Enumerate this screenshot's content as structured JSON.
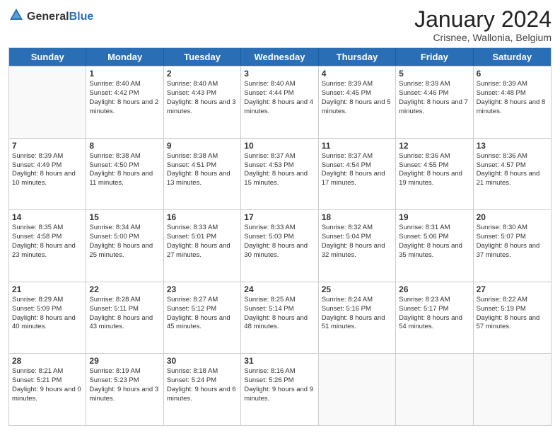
{
  "header": {
    "logo_general": "General",
    "logo_blue": "Blue",
    "month": "January 2024",
    "location": "Crisnee, Wallonia, Belgium"
  },
  "days_of_week": [
    "Sunday",
    "Monday",
    "Tuesday",
    "Wednesday",
    "Thursday",
    "Friday",
    "Saturday"
  ],
  "weeks": [
    [
      {
        "day": "",
        "sunrise": "",
        "sunset": "",
        "daylight": "",
        "empty": true
      },
      {
        "day": "1",
        "sunrise": "Sunrise: 8:40 AM",
        "sunset": "Sunset: 4:42 PM",
        "daylight": "Daylight: 8 hours and 2 minutes.",
        "empty": false
      },
      {
        "day": "2",
        "sunrise": "Sunrise: 8:40 AM",
        "sunset": "Sunset: 4:43 PM",
        "daylight": "Daylight: 8 hours and 3 minutes.",
        "empty": false
      },
      {
        "day": "3",
        "sunrise": "Sunrise: 8:40 AM",
        "sunset": "Sunset: 4:44 PM",
        "daylight": "Daylight: 8 hours and 4 minutes.",
        "empty": false
      },
      {
        "day": "4",
        "sunrise": "Sunrise: 8:39 AM",
        "sunset": "Sunset: 4:45 PM",
        "daylight": "Daylight: 8 hours and 5 minutes.",
        "empty": false
      },
      {
        "day": "5",
        "sunrise": "Sunrise: 8:39 AM",
        "sunset": "Sunset: 4:46 PM",
        "daylight": "Daylight: 8 hours and 7 minutes.",
        "empty": false
      },
      {
        "day": "6",
        "sunrise": "Sunrise: 8:39 AM",
        "sunset": "Sunset: 4:48 PM",
        "daylight": "Daylight: 8 hours and 8 minutes.",
        "empty": false
      }
    ],
    [
      {
        "day": "7",
        "sunrise": "Sunrise: 8:39 AM",
        "sunset": "Sunset: 4:49 PM",
        "daylight": "Daylight: 8 hours and 10 minutes.",
        "empty": false
      },
      {
        "day": "8",
        "sunrise": "Sunrise: 8:38 AM",
        "sunset": "Sunset: 4:50 PM",
        "daylight": "Daylight: 8 hours and 11 minutes.",
        "empty": false
      },
      {
        "day": "9",
        "sunrise": "Sunrise: 8:38 AM",
        "sunset": "Sunset: 4:51 PM",
        "daylight": "Daylight: 8 hours and 13 minutes.",
        "empty": false
      },
      {
        "day": "10",
        "sunrise": "Sunrise: 8:37 AM",
        "sunset": "Sunset: 4:53 PM",
        "daylight": "Daylight: 8 hours and 15 minutes.",
        "empty": false
      },
      {
        "day": "11",
        "sunrise": "Sunrise: 8:37 AM",
        "sunset": "Sunset: 4:54 PM",
        "daylight": "Daylight: 8 hours and 17 minutes.",
        "empty": false
      },
      {
        "day": "12",
        "sunrise": "Sunrise: 8:36 AM",
        "sunset": "Sunset: 4:55 PM",
        "daylight": "Daylight: 8 hours and 19 minutes.",
        "empty": false
      },
      {
        "day": "13",
        "sunrise": "Sunrise: 8:36 AM",
        "sunset": "Sunset: 4:57 PM",
        "daylight": "Daylight: 8 hours and 21 minutes.",
        "empty": false
      }
    ],
    [
      {
        "day": "14",
        "sunrise": "Sunrise: 8:35 AM",
        "sunset": "Sunset: 4:58 PM",
        "daylight": "Daylight: 8 hours and 23 minutes.",
        "empty": false
      },
      {
        "day": "15",
        "sunrise": "Sunrise: 8:34 AM",
        "sunset": "Sunset: 5:00 PM",
        "daylight": "Daylight: 8 hours and 25 minutes.",
        "empty": false
      },
      {
        "day": "16",
        "sunrise": "Sunrise: 8:33 AM",
        "sunset": "Sunset: 5:01 PM",
        "daylight": "Daylight: 8 hours and 27 minutes.",
        "empty": false
      },
      {
        "day": "17",
        "sunrise": "Sunrise: 8:33 AM",
        "sunset": "Sunset: 5:03 PM",
        "daylight": "Daylight: 8 hours and 30 minutes.",
        "empty": false
      },
      {
        "day": "18",
        "sunrise": "Sunrise: 8:32 AM",
        "sunset": "Sunset: 5:04 PM",
        "daylight": "Daylight: 8 hours and 32 minutes.",
        "empty": false
      },
      {
        "day": "19",
        "sunrise": "Sunrise: 8:31 AM",
        "sunset": "Sunset: 5:06 PM",
        "daylight": "Daylight: 8 hours and 35 minutes.",
        "empty": false
      },
      {
        "day": "20",
        "sunrise": "Sunrise: 8:30 AM",
        "sunset": "Sunset: 5:07 PM",
        "daylight": "Daylight: 8 hours and 37 minutes.",
        "empty": false
      }
    ],
    [
      {
        "day": "21",
        "sunrise": "Sunrise: 8:29 AM",
        "sunset": "Sunset: 5:09 PM",
        "daylight": "Daylight: 8 hours and 40 minutes.",
        "empty": false
      },
      {
        "day": "22",
        "sunrise": "Sunrise: 8:28 AM",
        "sunset": "Sunset: 5:11 PM",
        "daylight": "Daylight: 8 hours and 43 minutes.",
        "empty": false
      },
      {
        "day": "23",
        "sunrise": "Sunrise: 8:27 AM",
        "sunset": "Sunset: 5:12 PM",
        "daylight": "Daylight: 8 hours and 45 minutes.",
        "empty": false
      },
      {
        "day": "24",
        "sunrise": "Sunrise: 8:25 AM",
        "sunset": "Sunset: 5:14 PM",
        "daylight": "Daylight: 8 hours and 48 minutes.",
        "empty": false
      },
      {
        "day": "25",
        "sunrise": "Sunrise: 8:24 AM",
        "sunset": "Sunset: 5:16 PM",
        "daylight": "Daylight: 8 hours and 51 minutes.",
        "empty": false
      },
      {
        "day": "26",
        "sunrise": "Sunrise: 8:23 AM",
        "sunset": "Sunset: 5:17 PM",
        "daylight": "Daylight: 8 hours and 54 minutes.",
        "empty": false
      },
      {
        "day": "27",
        "sunrise": "Sunrise: 8:22 AM",
        "sunset": "Sunset: 5:19 PM",
        "daylight": "Daylight: 8 hours and 57 minutes.",
        "empty": false
      }
    ],
    [
      {
        "day": "28",
        "sunrise": "Sunrise: 8:21 AM",
        "sunset": "Sunset: 5:21 PM",
        "daylight": "Daylight: 9 hours and 0 minutes.",
        "empty": false
      },
      {
        "day": "29",
        "sunrise": "Sunrise: 8:19 AM",
        "sunset": "Sunset: 5:23 PM",
        "daylight": "Daylight: 9 hours and 3 minutes.",
        "empty": false
      },
      {
        "day": "30",
        "sunrise": "Sunrise: 8:18 AM",
        "sunset": "Sunset: 5:24 PM",
        "daylight": "Daylight: 9 hours and 6 minutes.",
        "empty": false
      },
      {
        "day": "31",
        "sunrise": "Sunrise: 8:16 AM",
        "sunset": "Sunset: 5:26 PM",
        "daylight": "Daylight: 9 hours and 9 minutes.",
        "empty": false
      },
      {
        "day": "",
        "sunrise": "",
        "sunset": "",
        "daylight": "",
        "empty": true
      },
      {
        "day": "",
        "sunrise": "",
        "sunset": "",
        "daylight": "",
        "empty": true
      },
      {
        "day": "",
        "sunrise": "",
        "sunset": "",
        "daylight": "",
        "empty": true
      }
    ]
  ]
}
